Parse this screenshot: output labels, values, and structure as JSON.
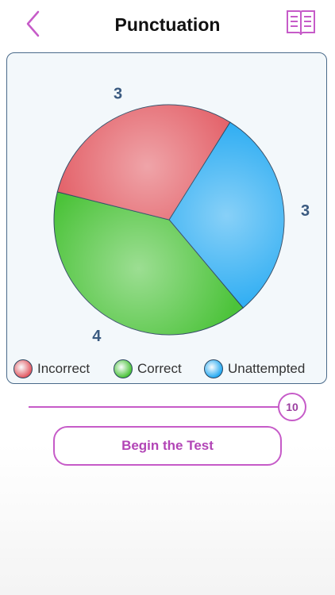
{
  "header": {
    "title": "Punctuation"
  },
  "chart_data": {
    "type": "pie",
    "categories": [
      "Incorrect",
      "Correct",
      "Unattempted"
    ],
    "values": [
      3,
      4,
      3
    ],
    "colors": [
      "#e25a62",
      "#4cc33a",
      "#26aaf2"
    ],
    "slice_labels": [
      "3",
      "4",
      "3"
    ]
  },
  "legend": {
    "items": [
      {
        "label": "Incorrect",
        "color": "#e25a62"
      },
      {
        "label": "Correct",
        "color": "#4cc33a"
      },
      {
        "label": "Unattempted",
        "color": "#26aaf2"
      }
    ]
  },
  "slider": {
    "value": "10"
  },
  "actions": {
    "begin_label": "Begin the Test"
  }
}
